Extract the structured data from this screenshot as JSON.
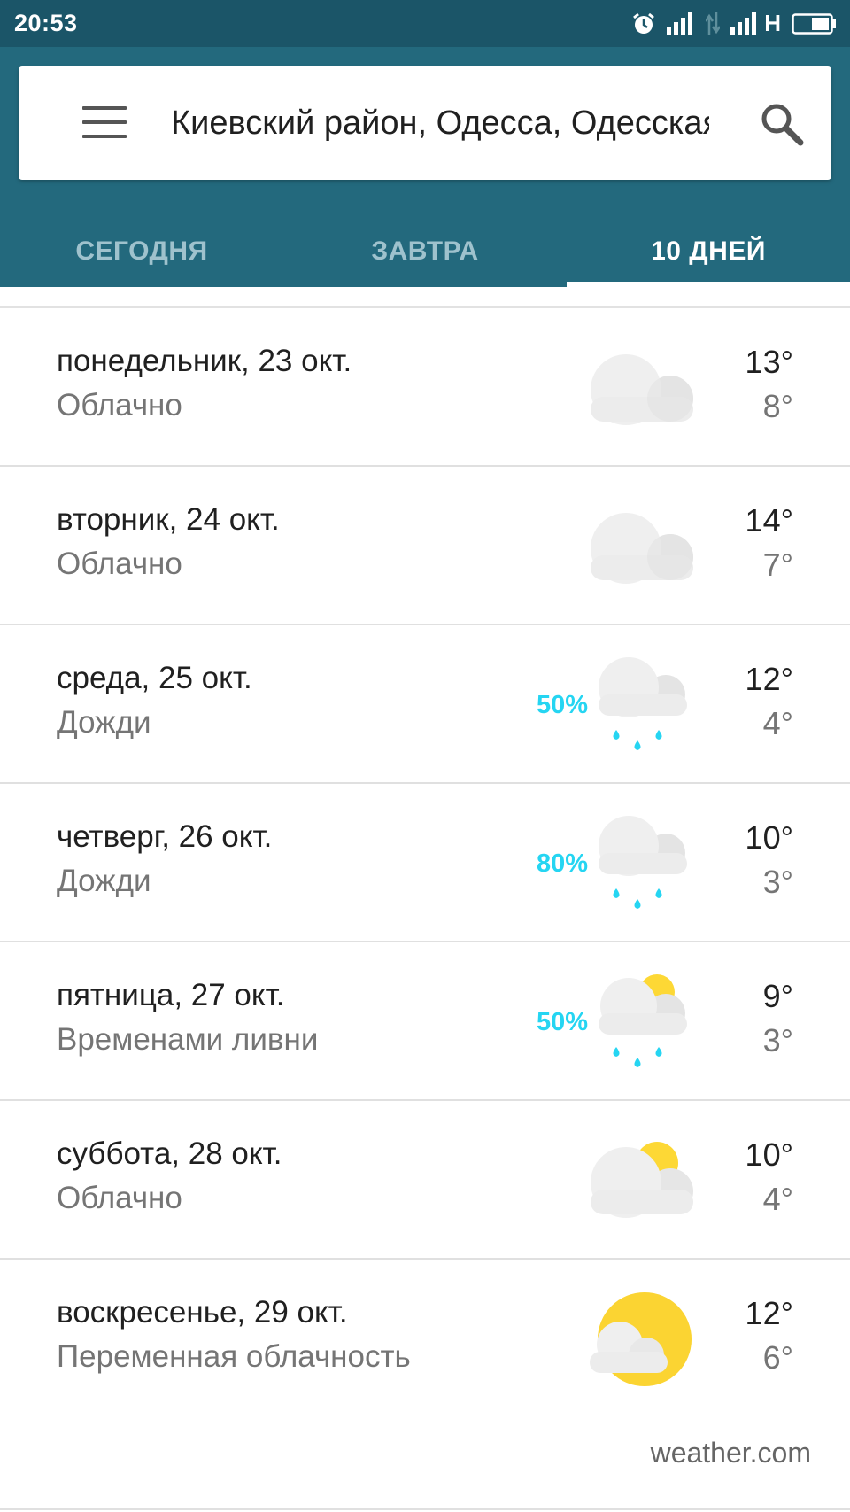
{
  "status_bar": {
    "time": "20:53",
    "network_label": "H",
    "icons": [
      "alarm-icon",
      "signal-icon",
      "data-transfer-icon",
      "signal-icon",
      "battery-icon"
    ]
  },
  "header": {
    "location": "Киевский район, Одесса, Одесская область",
    "tabs": [
      {
        "label": "СЕГОДНЯ",
        "active": false
      },
      {
        "label": "ЗАВТРА",
        "active": false
      },
      {
        "label": "10 ДНЕЙ",
        "active": true
      }
    ],
    "colors": {
      "bar": "#23697d",
      "status": "#1b5568",
      "precip": "#25d5f2",
      "sun": "#fdd835"
    }
  },
  "days": [
    {
      "date": "понедельник, 23 окт.",
      "condition": "Облачно",
      "precip": "",
      "icon": "cloudy-icon",
      "hi": "13°",
      "lo": "8°"
    },
    {
      "date": "вторник, 24 окт.",
      "condition": "Облачно",
      "precip": "",
      "icon": "cloudy-icon",
      "hi": "14°",
      "lo": "7°"
    },
    {
      "date": "среда, 25 окт.",
      "condition": "Дожди",
      "precip": "50%",
      "icon": "rain-icon",
      "hi": "12°",
      "lo": "4°"
    },
    {
      "date": "четверг, 26 окт.",
      "condition": "Дожди",
      "precip": "80%",
      "icon": "rain-icon",
      "hi": "10°",
      "lo": "3°"
    },
    {
      "date": "пятница, 27 окт.",
      "condition": "Временами ливни",
      "precip": "50%",
      "icon": "sun-rain-icon",
      "hi": "9°",
      "lo": "3°"
    },
    {
      "date": "суббота, 28 окт.",
      "condition": "Облачно",
      "precip": "",
      "icon": "cloud-sun-icon",
      "hi": "10°",
      "lo": "4°"
    },
    {
      "date": "воскресенье, 29 окт.",
      "condition": "Переменная облачность",
      "precip": "",
      "icon": "partly-cloudy-icon",
      "hi": "12°",
      "lo": "6°"
    }
  ],
  "attribution": "weather.com"
}
